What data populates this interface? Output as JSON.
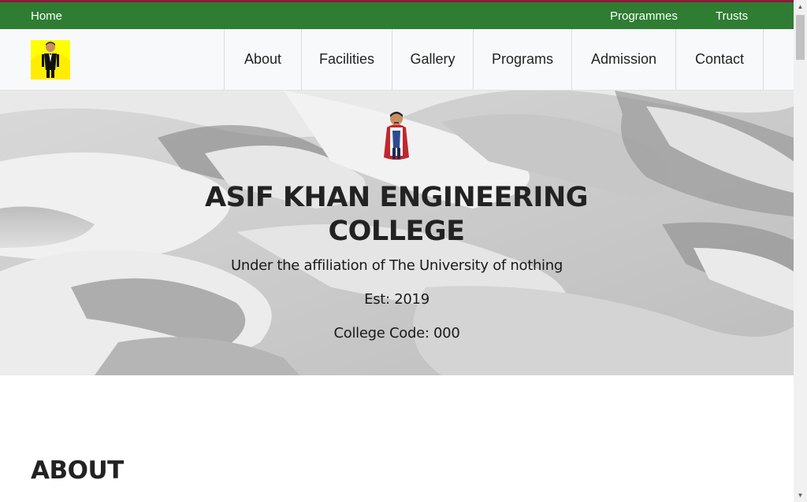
{
  "topbar": {
    "home_label": "Home",
    "programmes_label": "Programmes",
    "trusts_label": "Trusts"
  },
  "navbar": {
    "items": [
      {
        "label": "About"
      },
      {
        "label": "Facilities"
      },
      {
        "label": "Gallery"
      },
      {
        "label": "Programs"
      },
      {
        "label": "Admission"
      },
      {
        "label": "Contact"
      }
    ]
  },
  "hero": {
    "title": "ASIF KHAN ENGINEERING COLLEGE",
    "affiliation": "Under the affiliation of The University of nothing",
    "established": "Est: 2019",
    "college_code": "College Code: 000"
  },
  "about": {
    "heading": "ABOUT"
  },
  "colors": {
    "topbar_bg": "#2e7d32",
    "accent_stripe": "#8a1c3a",
    "navbar_bg": "#f8f9fa",
    "logo_bg": "#ffff00"
  },
  "icons": {
    "logo": "man-in-tuxedo-icon",
    "hero_emblem": "king-caricature-icon",
    "scroll_up": "scroll-up-arrow-icon",
    "scroll_down": "scroll-down-arrow-icon"
  }
}
